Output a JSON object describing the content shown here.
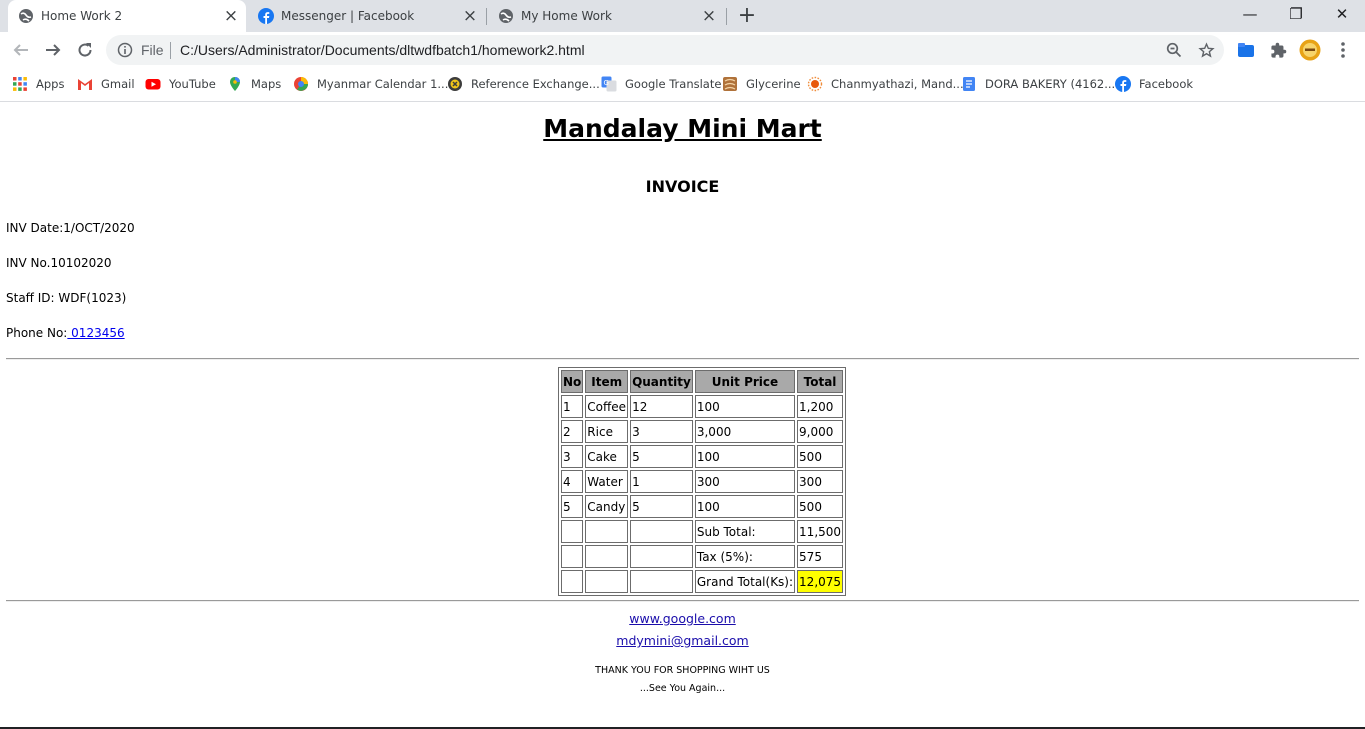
{
  "browser": {
    "tabs": [
      {
        "title": "Home Work 2",
        "icon": "globe-icon",
        "active": true
      },
      {
        "title": "Messenger | Facebook",
        "icon": "facebook-icon",
        "active": false
      },
      {
        "title": "My Home Work",
        "icon": "globe-icon",
        "active": false
      }
    ],
    "new_tab": "+",
    "window_controls": {
      "minimize": "—",
      "restore": "❐",
      "close": "✕"
    },
    "omnibox": {
      "scheme_label": "File",
      "url": "C:/Users/Administrator/Documents/dltwdfbatch1/homework2.html"
    },
    "bookmarks": [
      {
        "label": "Apps",
        "icon": "apps-grid-icon"
      },
      {
        "label": "Gmail",
        "icon": "gmail-icon"
      },
      {
        "label": "YouTube",
        "icon": "youtube-icon"
      },
      {
        "label": "Maps",
        "icon": "maps-pin-icon"
      },
      {
        "label": "Myanmar Calendar 1...",
        "icon": "calendar-icon"
      },
      {
        "label": "Reference Exchange...",
        "icon": "reference-icon"
      },
      {
        "label": "Google Translate",
        "icon": "translate-icon"
      },
      {
        "label": "Glycerine",
        "icon": "glycerine-icon"
      },
      {
        "label": "Chanmyathazi, Mand...",
        "icon": "sun-icon"
      },
      {
        "label": "DORA BAKERY (4162...",
        "icon": "doc-icon"
      },
      {
        "label": "Facebook",
        "icon": "facebook-icon"
      }
    ],
    "colors": {
      "tabstrip": "#dee1e6",
      "omnibox": "#f1f3f4",
      "highlight": "#ffff00",
      "header_cell": "#a9a9a9"
    }
  },
  "invoice": {
    "store_name": "Mandalay Mini Mart",
    "title": "INVOICE",
    "date_line": "INV Date:1/OCT/2020",
    "number_line": "INV No.10102020",
    "staff_line": "Staff ID: WDF(1023)",
    "phone_label": "Phone No:",
    "phone_value": " 0123456",
    "table": {
      "headers": [
        "No",
        "Item",
        "Quantity",
        "Unit Price",
        "Total"
      ],
      "rows": [
        [
          "1",
          "Coffee",
          "12",
          "100",
          "1,200"
        ],
        [
          "2",
          "Rice",
          "3",
          "3,000",
          "9,000"
        ],
        [
          "3",
          "Cake",
          "5",
          "100",
          "500"
        ],
        [
          "4",
          "Water",
          "1",
          "300",
          "300"
        ],
        [
          "5",
          "Candy",
          "5",
          "100",
          "500"
        ]
      ],
      "summary": [
        {
          "label": "Sub Total:",
          "value": "11,500"
        },
        {
          "label": "Tax (5%):",
          "value": "575"
        },
        {
          "label": "Grand Total(Ks):",
          "value": "12,075"
        }
      ]
    },
    "footer": {
      "website": "www.google.com",
      "email": "mdymini@gmail.com",
      "thanks": "THANK YOU FOR SHOPPING WIHT US",
      "farewell": "...See You Again..."
    }
  }
}
